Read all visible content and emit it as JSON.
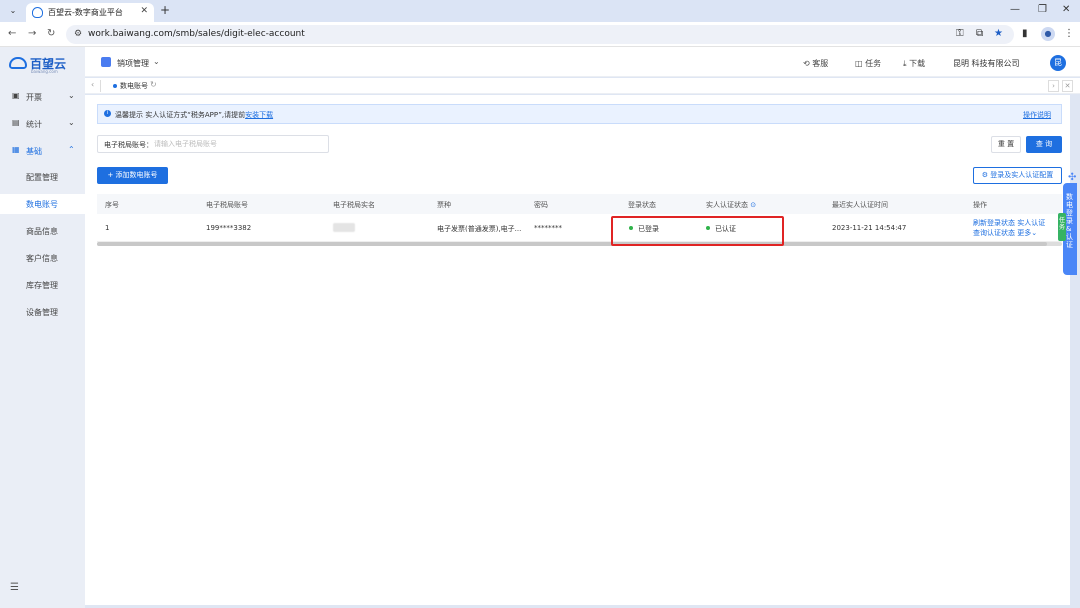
{
  "browser": {
    "tab_title": "百望云-数字商业平台",
    "url": "work.baiwang.com/smb/sales/digit-elec-account"
  },
  "logo": {
    "name": "百望云",
    "sub": "baiwang.com"
  },
  "sidebar": {
    "groups": [
      {
        "label": "开票"
      },
      {
        "label": "统计"
      },
      {
        "label": "基础"
      }
    ],
    "items": [
      {
        "label": "配置管理"
      },
      {
        "label": "数电账号"
      },
      {
        "label": "商品信息"
      },
      {
        "label": "客户信息"
      },
      {
        "label": "库存管理"
      },
      {
        "label": "设备管理"
      }
    ]
  },
  "header": {
    "module": "销项管理",
    "service": "客服",
    "tasks": "任务",
    "download": "下载",
    "company": "昆明        科技有限公司",
    "avatar": "昆"
  },
  "tabstrip": {
    "tab": "数电账号"
  },
  "notice": {
    "prefix": "温馨提示",
    "text": "实人认证方式“税务APP”,请提前",
    "link": "安装下载",
    "help": "操作说明"
  },
  "search": {
    "label": "电子税局账号：",
    "placeholder": "请输入电子税局账号"
  },
  "buttons": {
    "reset": "重 置",
    "query": "查 询",
    "add": "+ 添加数电账号",
    "config": "⚙ 登录及实人认证配置"
  },
  "table": {
    "headers": [
      "序号",
      "电子税局账号",
      "电子税局实名",
      "票种",
      "密码",
      "登录状态",
      "实人认证状态",
      "最近实人认证时间",
      "操作"
    ],
    "rows": [
      {
        "index": "1",
        "account": "199****3382",
        "invoice_type": "电子发票(普通发票),电子...",
        "password": "********",
        "login_status": "已登录",
        "auth_status": "已认证",
        "last_auth_time": "2023-11-21 14:54:47",
        "op1": "刷新登录状态",
        "op2": "实人认证",
        "op3": "查询认证状态",
        "op4": "更多"
      }
    ]
  },
  "float": {
    "tab": "数电登录&认证",
    "green": "任务"
  },
  "colors": {
    "accent": "#1e6fe0",
    "success": "#2fb34a",
    "highlight": "#e02424"
  }
}
